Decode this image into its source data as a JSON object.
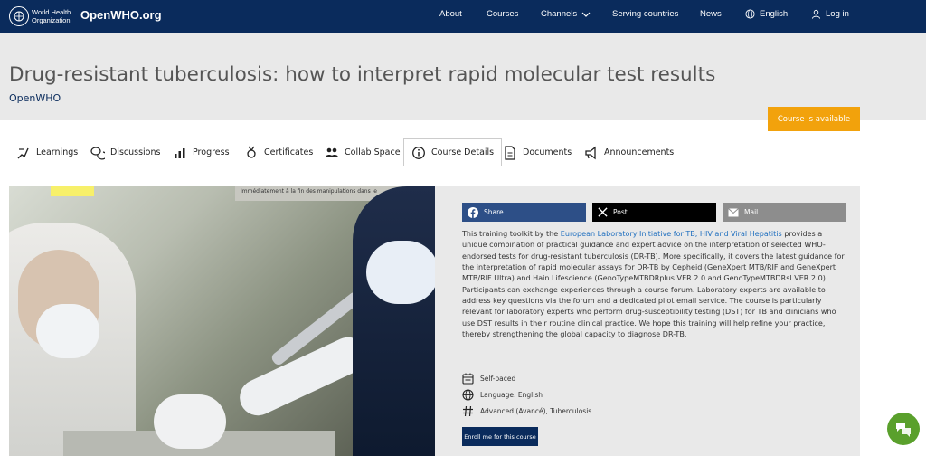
{
  "brand": {
    "who_name_line1": "World Health",
    "who_name_line2": "Organization",
    "site_name": "OpenWHO.org"
  },
  "nav": {
    "about": "About",
    "courses": "Courses",
    "channels": "Channels",
    "serving_countries": "Serving countries",
    "news": "News",
    "language": "English",
    "login": "Log in"
  },
  "header": {
    "title": "Drug-resistant tuberculosis: how to interpret rapid molecular test results",
    "subtitle": "OpenWHO",
    "status_badge": "Course is available"
  },
  "tabs": [
    {
      "label": "Learnings",
      "icon": "learnings-icon"
    },
    {
      "label": "Discussions",
      "icon": "discussions-icon"
    },
    {
      "label": "Progress",
      "icon": "progress-icon"
    },
    {
      "label": "Certificates",
      "icon": "certificate-icon"
    },
    {
      "label": "Collab Space",
      "icon": "collab-space-icon"
    },
    {
      "label": "Course Details",
      "icon": "info-icon"
    },
    {
      "label": "Documents",
      "icon": "document-icon"
    },
    {
      "label": "Announcements",
      "icon": "announcements-icon"
    }
  ],
  "photo": {
    "sign_text": "Immédiatement à la fin des manipulations dans le"
  },
  "share": {
    "facebook": "Share",
    "x": "Post",
    "mail": "Mail"
  },
  "description": {
    "p1_before_link": "This training toolkit by the ",
    "link_text": "European Laboratory Initiative for TB, HIV and Viral Hepatitis",
    "p1_after_link": " provides a unique combination of practical guidance and expert advice on the interpretation of selected WHO-endorsed tests for drug-resistant tuberculosis (DR-TB). More specifically, it covers the latest guidance for the interpretation of rapid molecular assays for DR-TB by Cepheid (GeneXpert MTB/RIF and GeneXpert MTB/RIF Ultra) and Hain Lifescience (GenoTypeMTBDRplus VER 2.0 and GenoTypeMTBDRsl VER 2.0). Participants can exchange experiences through a course forum. Laboratory experts are available to address key questions via the forum and a dedicated pilot email service. The course is particularly relevant for laboratory experts who perform drug-susceptibility testing (DST) for TB and clinicians who use DST results in their routine clinical practice. We hope this training will help refine your practice, thereby strengthening the global capacity to diagnose DR-TB."
  },
  "meta": {
    "pace": "Self-paced",
    "language": "Language: English",
    "tags": "Advanced (Avancé), Tuberculosis"
  },
  "enroll_label": "Enroll me for this course",
  "colors": {
    "nav_bg": "#0a2b5c",
    "badge": "#f2a20c",
    "facebook": "#2d4f87",
    "chat": "#5aa02c"
  }
}
